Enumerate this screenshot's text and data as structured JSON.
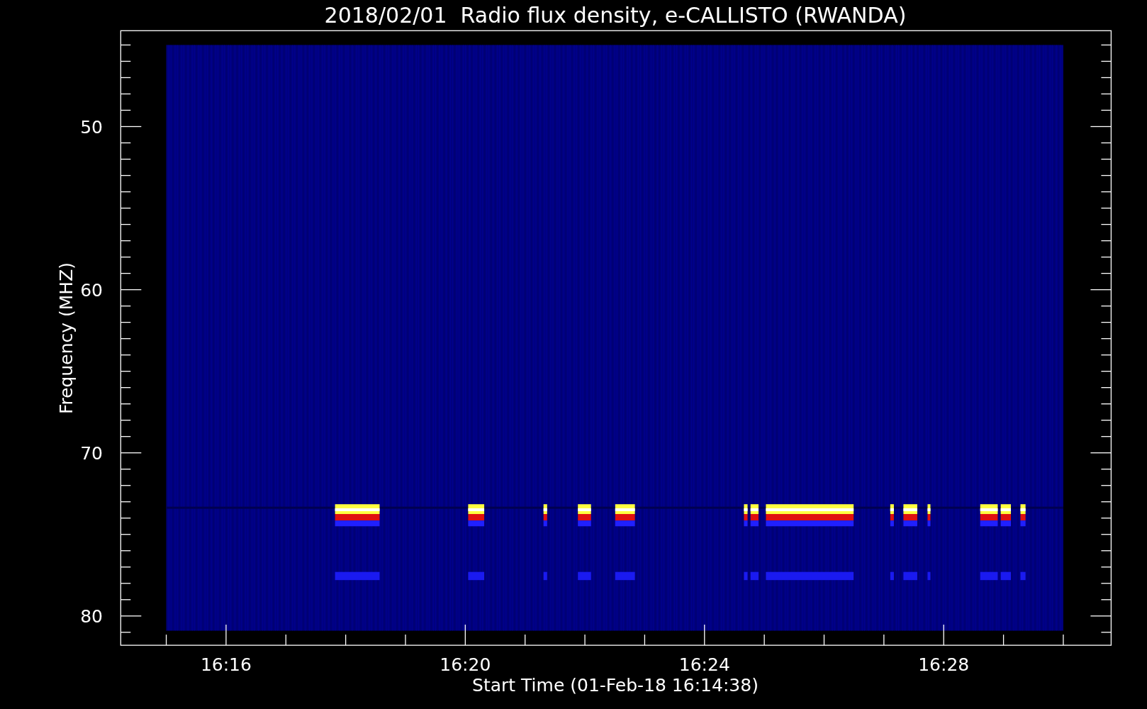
{
  "plot": {
    "title": "2018/02/01  Radio flux density, e-CALLISTO (RWANDA)",
    "xlabel": "Start Time (01-Feb-18 16:14:38)",
    "ylabel": "Frequency (MHZ)",
    "xticks": [
      "16:16",
      "16:20",
      "16:24",
      "16:28"
    ],
    "yticks": [
      "50",
      "60",
      "70",
      "80"
    ]
  }
}
